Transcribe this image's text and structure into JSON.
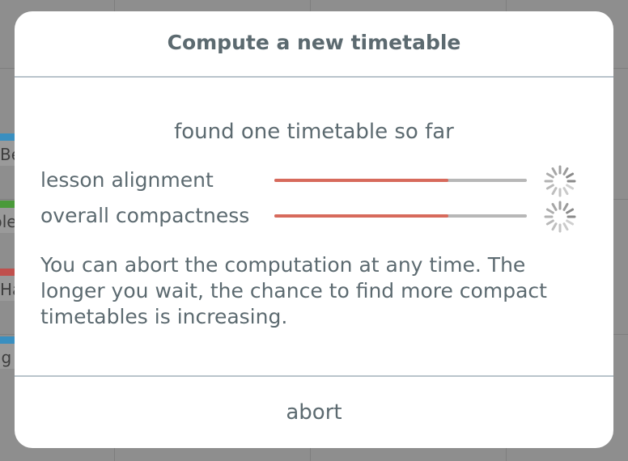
{
  "background": {
    "cells": [
      {
        "text": "Be",
        "stripe_color": "#3a8fc0"
      },
      {
        "text": "ble",
        "stripe_color": "#4a9a3a"
      },
      {
        "text": "Ha",
        "stripe_color": "#c0504d"
      },
      {
        "text": "ig",
        "stripe_color": "#3a8fc0"
      }
    ]
  },
  "modal": {
    "title": "Compute a new timetable",
    "status": "found one timetable so far",
    "metrics": [
      {
        "label": "lesson alignment",
        "progress": 0.69,
        "spinner_icon": "loading-spinner-icon"
      },
      {
        "label": "overall compactness",
        "progress": 0.69,
        "spinner_icon": "loading-spinner-icon"
      }
    ],
    "hint": "You can abort the computation at any time. The longer you wait, the chance to find more compact timetables is increasing.",
    "abort_label": "abort"
  },
  "colors": {
    "accent": "#d76a5c",
    "track": "#b7b7b7",
    "text": "#5c6a70",
    "divider": "#b9c4cb"
  }
}
